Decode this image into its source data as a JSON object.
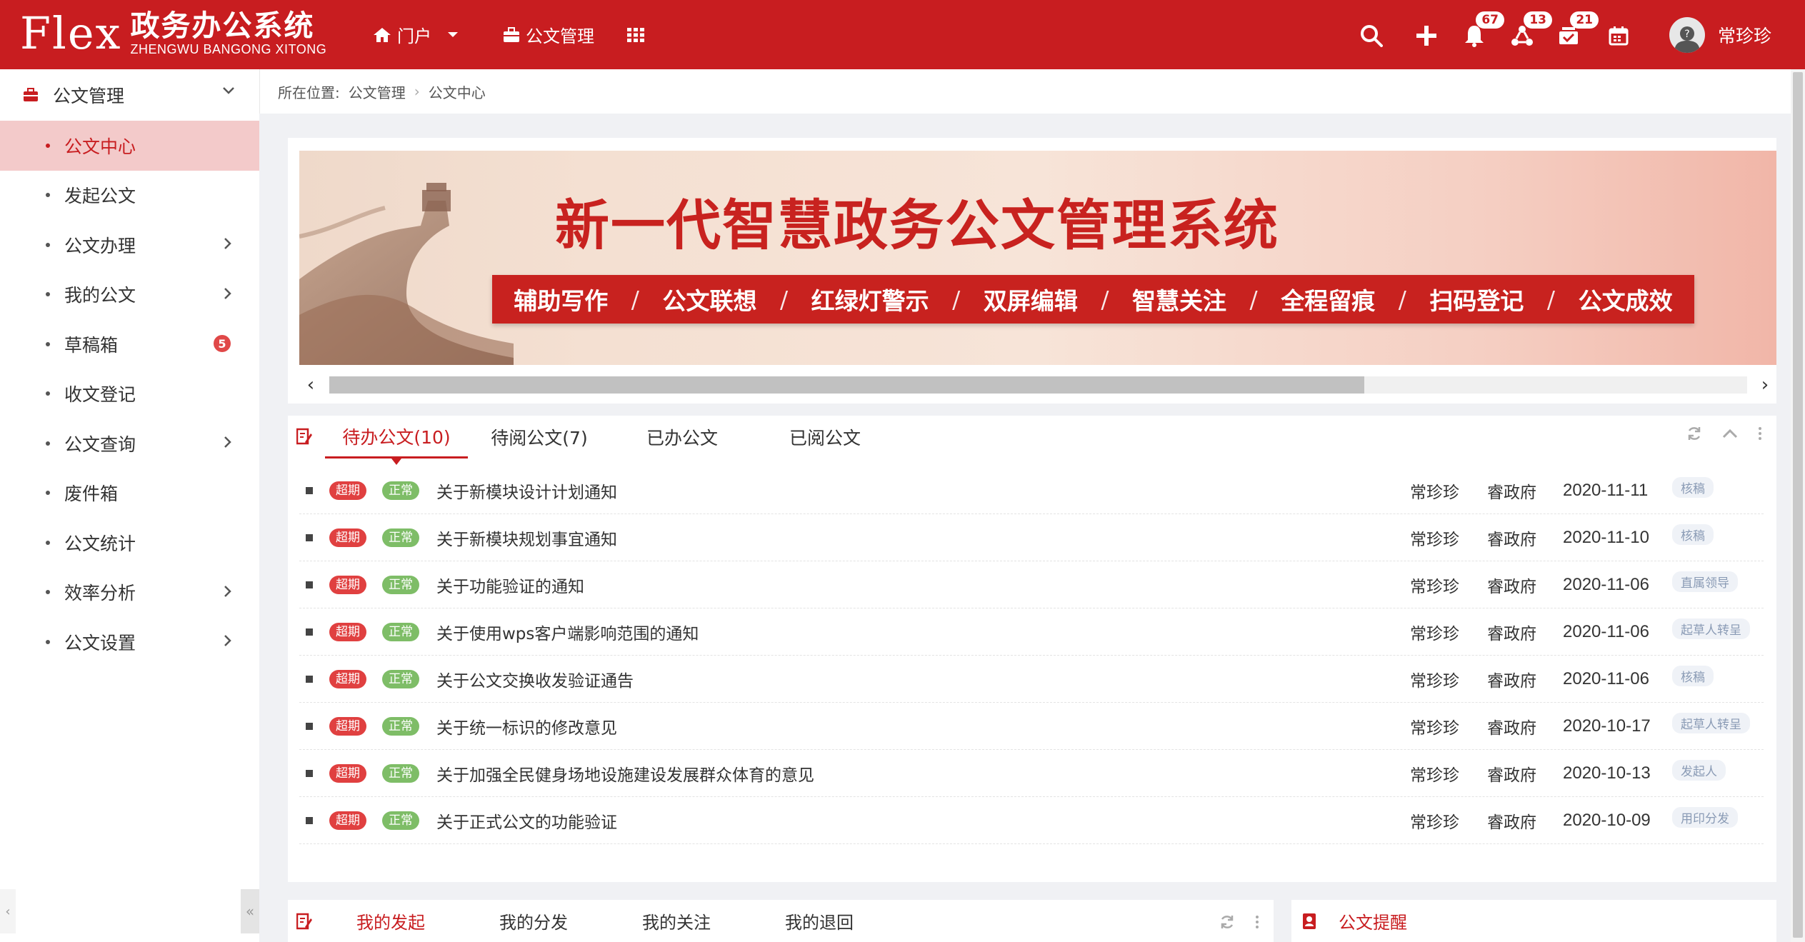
{
  "header": {
    "logo_mark": "Flex",
    "logo_cn": "政务办公系统",
    "logo_pinyin": "ZHENGWU BANGONG XITONG",
    "nav_portal": "门户",
    "nav_doc_mgmt": "公文管理",
    "badges": {
      "notify": "67",
      "workflow": "13",
      "tasks": "21"
    },
    "user_name": "常珍珍"
  },
  "sidebar": {
    "group_label": "公文管理",
    "items": [
      {
        "label": "公文中心",
        "active": true
      },
      {
        "label": "发起公文"
      },
      {
        "label": "公文办理",
        "has_children": true
      },
      {
        "label": "我的公文",
        "has_children": true
      },
      {
        "label": "草稿箱",
        "badge": "5"
      },
      {
        "label": "收文登记"
      },
      {
        "label": "公文查询",
        "has_children": true
      },
      {
        "label": "废件箱"
      },
      {
        "label": "公文统计"
      },
      {
        "label": "效率分析",
        "has_children": true
      },
      {
        "label": "公文设置",
        "has_children": true
      }
    ]
  },
  "breadcrumb": {
    "prefix": "所在位置:",
    "level1": "公文管理",
    "level2": "公文中心"
  },
  "banner": {
    "title": "新一代智慧政务公文管理系统",
    "features": [
      "辅助写作",
      "公文联想",
      "红绿灯警示",
      "双屏编辑",
      "智慧关注",
      "全程留痕",
      "扫码登记",
      "公文成效"
    ],
    "slash": "/",
    "scroll_position": 0.73
  },
  "todo": {
    "tabs": [
      "待办公文(10)",
      "待阅公文(7)",
      "已办公文",
      "已阅公文"
    ],
    "active_tab": 0,
    "rows": [
      {
        "tag1": "超期",
        "tag2": "正常",
        "title": "关于新模块设计计划通知",
        "person": "常珍珍",
        "dept": "睿政府",
        "date": "2020-11-11",
        "step": "核稿"
      },
      {
        "tag1": "超期",
        "tag2": "正常",
        "title": "关于新模块规划事宜通知",
        "person": "常珍珍",
        "dept": "睿政府",
        "date": "2020-11-10",
        "step": "核稿"
      },
      {
        "tag1": "超期",
        "tag2": "正常",
        "title": "关于功能验证的通知",
        "person": "常珍珍",
        "dept": "睿政府",
        "date": "2020-11-06",
        "step": "直属领导"
      },
      {
        "tag1": "超期",
        "tag2": "正常",
        "title": "关于使用wps客户端影响范围的通知",
        "person": "常珍珍",
        "dept": "睿政府",
        "date": "2020-11-06",
        "step": "起草人转呈"
      },
      {
        "tag1": "超期",
        "tag2": "正常",
        "title": "关于公文交换收发验证通告",
        "person": "常珍珍",
        "dept": "睿政府",
        "date": "2020-11-06",
        "step": "核稿"
      },
      {
        "tag1": "超期",
        "tag2": "正常",
        "title": "关于统一标识的修改意见",
        "person": "常珍珍",
        "dept": "睿政府",
        "date": "2020-10-17",
        "step": "起草人转呈"
      },
      {
        "tag1": "超期",
        "tag2": "正常",
        "title": "关于加强全民健身场地设施建设发展群众体育的意见",
        "person": "常珍珍",
        "dept": "睿政府",
        "date": "2020-10-13",
        "step": "发起人"
      },
      {
        "tag1": "超期",
        "tag2": "正常",
        "title": "关于正式公文的功能验证",
        "person": "常珍珍",
        "dept": "睿政府",
        "date": "2020-10-09",
        "step": "用印分发"
      }
    ]
  },
  "mine": {
    "tabs": [
      "我的发起",
      "我的分发",
      "我的关注",
      "我的退回"
    ],
    "active_tab": 0
  },
  "remind": {
    "title": "公文提醒"
  },
  "colors": {
    "brand_red": "#c81d20",
    "overdue": "#e04040",
    "normal": "#7ebd67",
    "active_bg": "#f3caca"
  }
}
